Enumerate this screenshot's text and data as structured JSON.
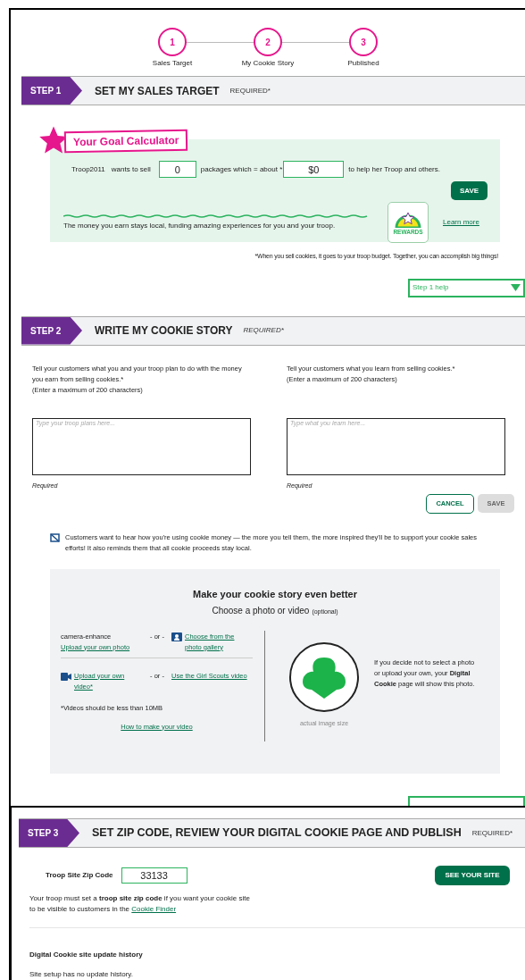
{
  "stepper": [
    {
      "number": "1",
      "label": "Sales Target"
    },
    {
      "number": "2",
      "label": "My Cookie Story"
    },
    {
      "number": "3",
      "label": "Published"
    }
  ],
  "step1": {
    "badge": "STEP 1",
    "title": "SET MY SALES TARGET",
    "required": "REQUIRED*",
    "calculator": {
      "title": "Your Goal Calculator",
      "troop": "Troop2011",
      "text_1": "wants to sell",
      "packages": "0",
      "text_2": "packages which = about *",
      "amount": "$0",
      "text_3": "to help her Troop and others.",
      "save": "SAVE",
      "message": "The money you earn stays local, funding amazing experiences for you and your troop.",
      "rewards_label": "REWARDS",
      "learn_more": "Learn more"
    },
    "footnote": "*When you sell cookies, it goes to your troop budget. Together, you can accomplish big things!",
    "help": "Step 1 help"
  },
  "step2": {
    "badge": "STEP 2",
    "title": "WRITE MY COOKIE STORY",
    "required": "REQUIRED*",
    "fields": [
      {
        "label": "Tell your customers what you and your troop plan to do with the money you earn from selling cookies.*",
        "limit": "(Enter a maximum of 200 characters)",
        "placeholder": "Type your troop plans here...",
        "note": "Required"
      },
      {
        "label": "Tell your customers what you learn from selling cookies.*",
        "limit": "(Enter a maximum of 200 characters)",
        "placeholder": "Type what you learn here...",
        "note": "Required"
      }
    ],
    "cancel": "CANCEL",
    "save": "SAVE",
    "save_disabled": true,
    "info": "Customers want to hear how you're using cookie money — the more you tell them, the more inspired they'll be to support your cookie sales efforts! It also reminds them that all cookie proceeds stay local.",
    "media": {
      "title": "Make your cookie story even better",
      "subtitle": "Choose a photo or video",
      "optional": "(optional)",
      "photo_icon_text": "camera-enhance",
      "upload_photo": "Upload your own photo",
      "or_1": "- or -",
      "gallery": "Choose from the photo gallery",
      "upload_video": "Upload your own video*",
      "or_2": "- or -",
      "scouts_video": "Use the Girl Scouts video",
      "video_note": "*Videos should be less than 10MB",
      "how_to": "How to make your video",
      "image_caption": "actual image size",
      "default_note": "If you decide not to select a photo or upload your own, your **Digital Cookie** page will show this photo."
    }
  },
  "step3": {
    "badge": "STEP 3",
    "title": "SET ZIP CODE, REVIEW YOUR DIGITAL COOKIE PAGE AND PUBLISH",
    "required": "REQUIRED*",
    "zip_label": "Troop Site Zip Code",
    "zip": "33133",
    "see_site": "SEE YOUR SITE",
    "zip_note": "Your troop must set a **troop site zip code** if you want your cookie site to be visible to customers in the",
    "cookie_finder": "Cookie Finder",
    "history_title": "Digital Cookie site update history",
    "history_text": "Site setup has no update history."
  }
}
